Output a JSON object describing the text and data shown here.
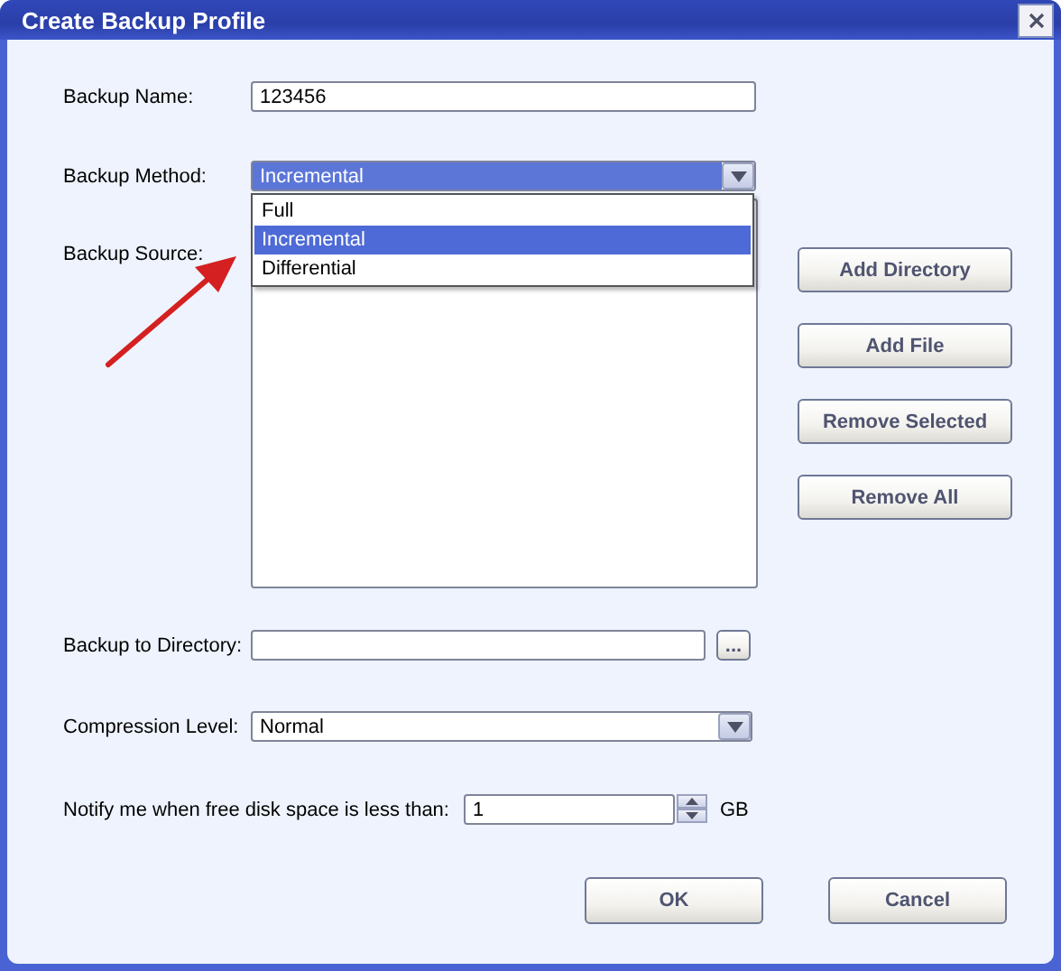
{
  "window": {
    "title": "Create Backup Profile"
  },
  "backup_name": {
    "label": "Backup Name:",
    "value": "123456"
  },
  "backup_method": {
    "label": "Backup Method:",
    "value": "Incremental",
    "focused": true,
    "expanded": true,
    "options": [
      {
        "label": "Full",
        "selected": false
      },
      {
        "label": "Incremental",
        "selected": true
      },
      {
        "label": "Differential",
        "selected": false
      }
    ]
  },
  "backup_source": {
    "label": "Backup Source:"
  },
  "source_buttons": [
    "Add Directory",
    "Add File",
    "Remove Selected",
    "Remove All"
  ],
  "backup_to_directory": {
    "label": "Backup to Directory:",
    "browse_button": "..."
  },
  "compression_level": {
    "label": "Compression Level:",
    "value": "Normal",
    "focused": false
  },
  "notify": {
    "label": "Notify me when free disk space is less than:",
    "value": "1",
    "unit": "GB"
  },
  "buttons": [
    "OK",
    "Cancel"
  ]
}
